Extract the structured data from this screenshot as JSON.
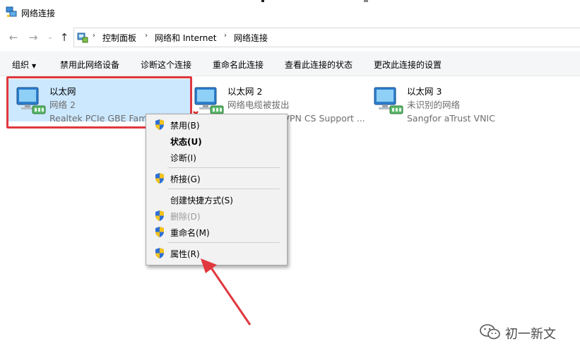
{
  "window": {
    "title": "网络连接",
    "icon": "network-connections-icon"
  },
  "nav": {
    "back_icon": "back-arrow-icon",
    "forward_icon": "forward-arrow-icon",
    "recent_icon": "chevron-down-icon",
    "up_icon": "up-arrow-icon"
  },
  "address": {
    "crumbs": [
      "控制面板",
      "网络和 Internet",
      "网络连接"
    ],
    "separator": "›"
  },
  "toolbar": {
    "organize": "组织",
    "disable_device": "禁用此网络设备",
    "diagnose": "诊断这个连接",
    "rename": "重命名此连接",
    "view_status": "查看此连接的状态",
    "change_settings": "更改此连接的设置"
  },
  "adapters": [
    {
      "name": "以太网",
      "status": "网络 2",
      "device": "Realtek PCIe GBE Family Contr...",
      "selected": true
    },
    {
      "name": "以太网 2",
      "status": "网络电缆被拔出",
      "device": "Sangfor SSL VPN CS Support ...",
      "selected": false
    },
    {
      "name": "以太网 3",
      "status": "未识别的网络",
      "device": "Sangfor aTrust VNIC",
      "selected": false
    }
  ],
  "context_menu": {
    "disable": "禁用(B)",
    "status": "状态(U)",
    "diagnose": "诊断(I)",
    "bridge": "桥接(G)",
    "shortcut": "创建快捷方式(S)",
    "delete": "删除(D)",
    "rename": "重命名(M)",
    "properties": "属性(R)"
  },
  "watermark": {
    "text": "初一新文"
  },
  "colors": {
    "highlight": "#e0383e",
    "selection": "#cce8ff",
    "menu_bg": "#f2f2f2",
    "toolbar_bg": "#f5f6f7"
  }
}
